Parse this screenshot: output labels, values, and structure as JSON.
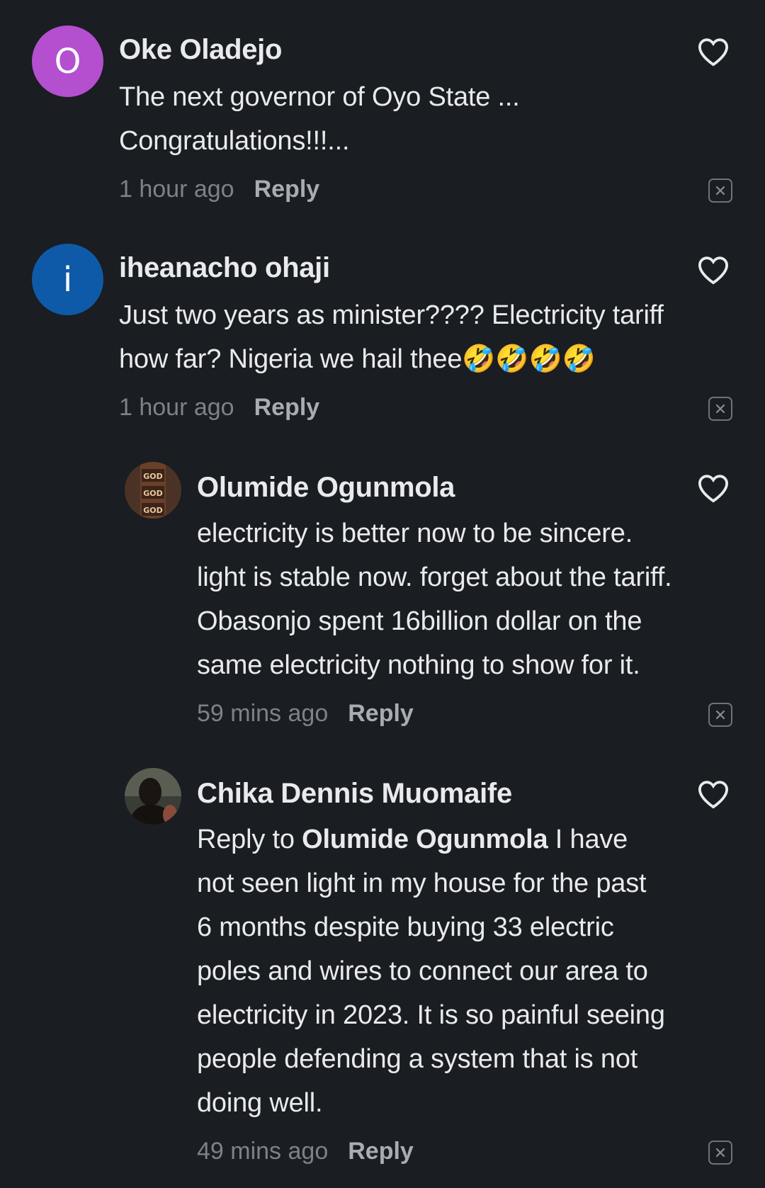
{
  "comments": [
    {
      "author": "Oke Oladejo",
      "avatar_letter": "O",
      "avatar_color": "#b44fd0",
      "text_lines": [
        "The next governor of Oyo State ...",
        "Congratulations!!!..."
      ],
      "time": "1 hour ago",
      "reply_label": "Reply"
    },
    {
      "author": "iheanacho ohaji",
      "avatar_letter": "i",
      "avatar_color": "#0f5aa8",
      "text_lines": [
        "Just two years as minister???? Electricity tariff",
        "how far? Nigeria we hail thee"
      ],
      "emoji": "🤣🤣🤣🤣",
      "time": "1 hour ago",
      "reply_label": "Reply"
    },
    {
      "author": "Olumide Ogunmola",
      "avatar_caption": "GOD",
      "text_lines": [
        "electricity is better now to be sincere.",
        "light is stable now. forget about the tariff.",
        "Obasonjo spent 16billion dollar on the",
        "same electricity nothing to show for it."
      ],
      "time": "59 mins ago",
      "reply_label": "Reply"
    },
    {
      "author": "Chika Dennis Muomaife",
      "reply_prefix": "Reply to",
      "reply_to": "Olumide Ogunmola",
      "first_line_rest": "I have",
      "text_lines": [
        "not seen light in my house for the past",
        "6 months despite buying 33 electric",
        "poles and wires to connect our area to",
        "electricity in 2023. It is so painful seeing",
        "people defending a system that is not",
        "doing well."
      ],
      "time": "49 mins ago",
      "reply_label": "Reply"
    }
  ]
}
